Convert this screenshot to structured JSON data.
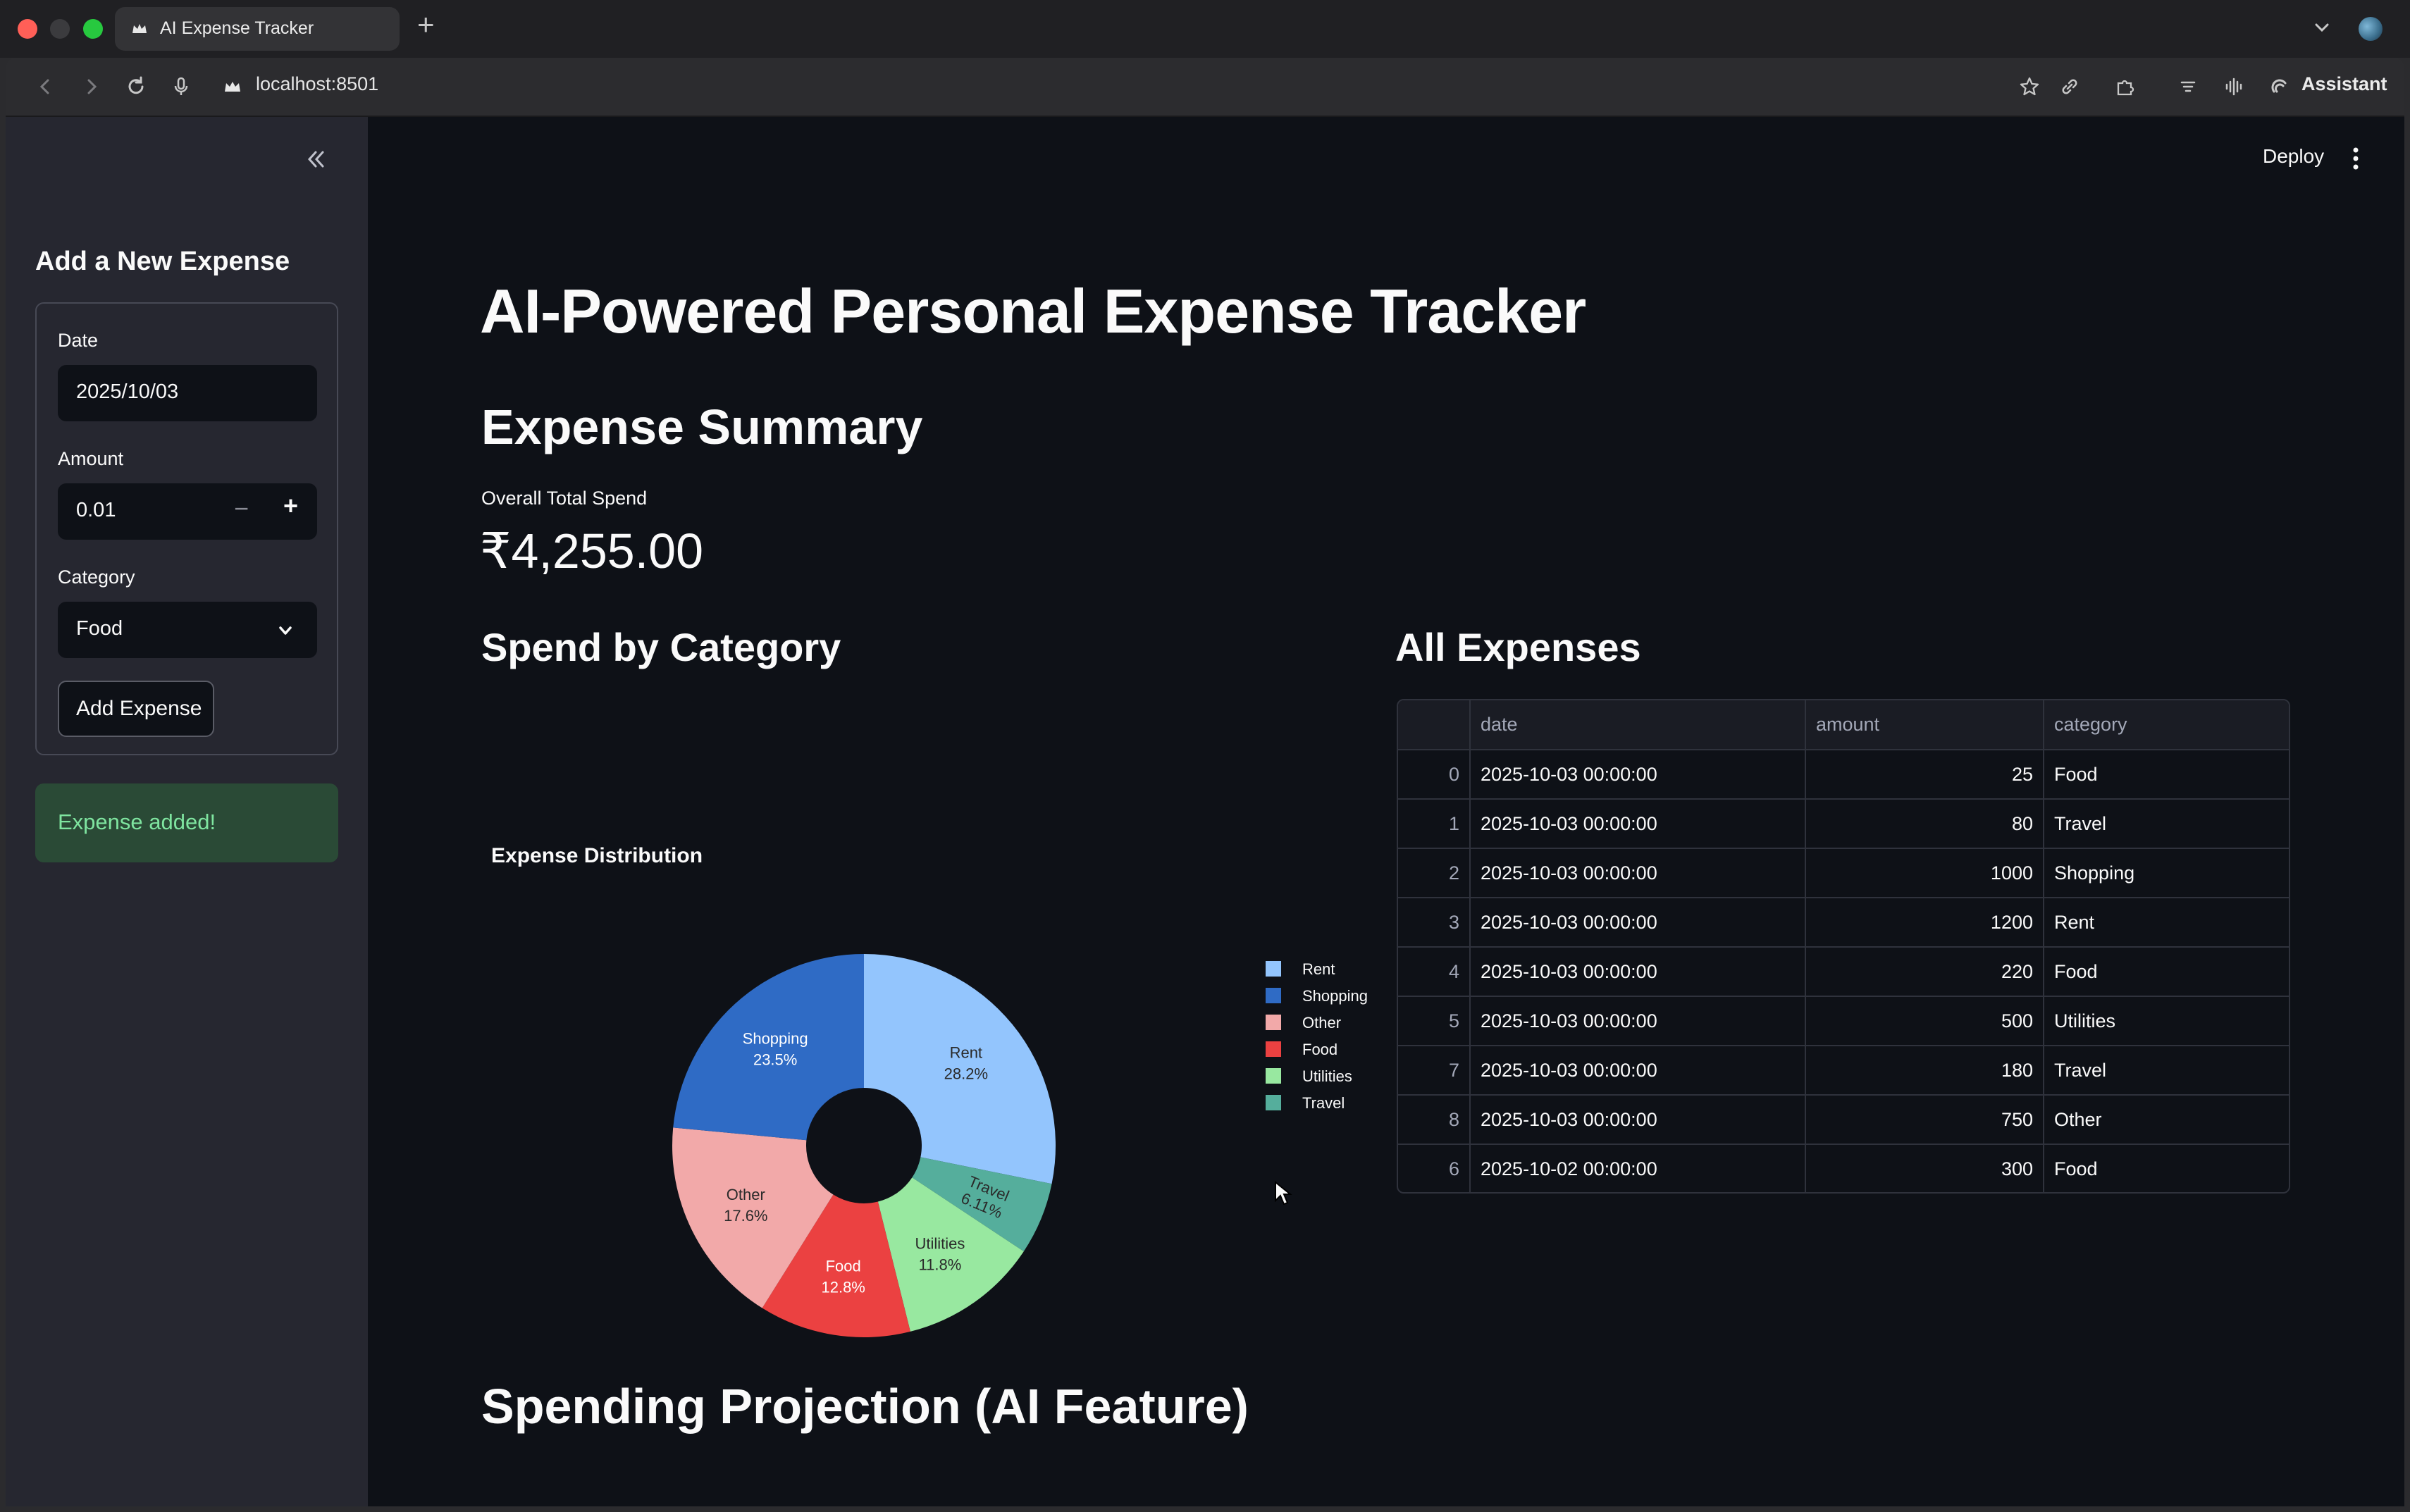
{
  "browser": {
    "tab_title": "AI Expense Tracker",
    "url": "localhost:8501",
    "assistant_label": "Assistant"
  },
  "sidebar": {
    "title": "Add a New Expense",
    "date_label": "Date",
    "date_value": "2025/10/03",
    "amount_label": "Amount",
    "amount_value": "0.01",
    "category_label": "Category",
    "category_value": "Food",
    "add_button_label": "Add Expense",
    "toast_message": "Expense added!"
  },
  "header": {
    "deploy_label": "Deploy"
  },
  "main": {
    "title": "AI-Powered Personal Expense Tracker",
    "summary_heading": "Expense Summary",
    "metric_label": "Overall Total Spend",
    "metric_value": "₹4,255.00",
    "category_heading": "Spend by Category",
    "expenses_heading": "All Expenses",
    "projection_heading": "Spending Projection (AI Feature)"
  },
  "chart_data": {
    "type": "pie",
    "title": "Expense Distribution",
    "donut": true,
    "legend_position": "right",
    "slices": [
      {
        "label": "Rent",
        "value": 28.2,
        "text": "28.2%",
        "color": "#93c5fd"
      },
      {
        "label": "Travel",
        "value": 6.11,
        "text": "6.11%",
        "color": "#55ae9c"
      },
      {
        "label": "Utilities",
        "value": 11.8,
        "text": "11.8%",
        "color": "#98e8a0"
      },
      {
        "label": "Food",
        "value": 12.8,
        "text": "12.8%",
        "color": "#eb4141"
      },
      {
        "label": "Other",
        "value": 17.6,
        "text": "17.6%",
        "color": "#f2a9a9"
      },
      {
        "label": "Shopping",
        "value": 23.5,
        "text": "23.5%",
        "color": "#2f6bc5"
      }
    ],
    "legend": [
      {
        "label": "Rent",
        "color": "#93c5fd"
      },
      {
        "label": "Shopping",
        "color": "#2f6bc5"
      },
      {
        "label": "Other",
        "color": "#f2a9a9"
      },
      {
        "label": "Food",
        "color": "#eb4141"
      },
      {
        "label": "Utilities",
        "color": "#98e8a0"
      },
      {
        "label": "Travel",
        "color": "#55ae9c"
      }
    ]
  },
  "table": {
    "columns": [
      "",
      "date",
      "amount",
      "category"
    ],
    "rows": [
      {
        "index": "0",
        "date": "2025-10-03 00:00:00",
        "amount": "25",
        "category": "Food"
      },
      {
        "index": "1",
        "date": "2025-10-03 00:00:00",
        "amount": "80",
        "category": "Travel"
      },
      {
        "index": "2",
        "date": "2025-10-03 00:00:00",
        "amount": "1000",
        "category": "Shopping"
      },
      {
        "index": "3",
        "date": "2025-10-03 00:00:00",
        "amount": "1200",
        "category": "Rent"
      },
      {
        "index": "4",
        "date": "2025-10-03 00:00:00",
        "amount": "220",
        "category": "Food"
      },
      {
        "index": "5",
        "date": "2025-10-03 00:00:00",
        "amount": "500",
        "category": "Utilities"
      },
      {
        "index": "7",
        "date": "2025-10-03 00:00:00",
        "amount": "180",
        "category": "Travel"
      },
      {
        "index": "8",
        "date": "2025-10-03 00:00:00",
        "amount": "750",
        "category": "Other"
      },
      {
        "index": "6",
        "date": "2025-10-02 00:00:00",
        "amount": "300",
        "category": "Food"
      }
    ]
  }
}
